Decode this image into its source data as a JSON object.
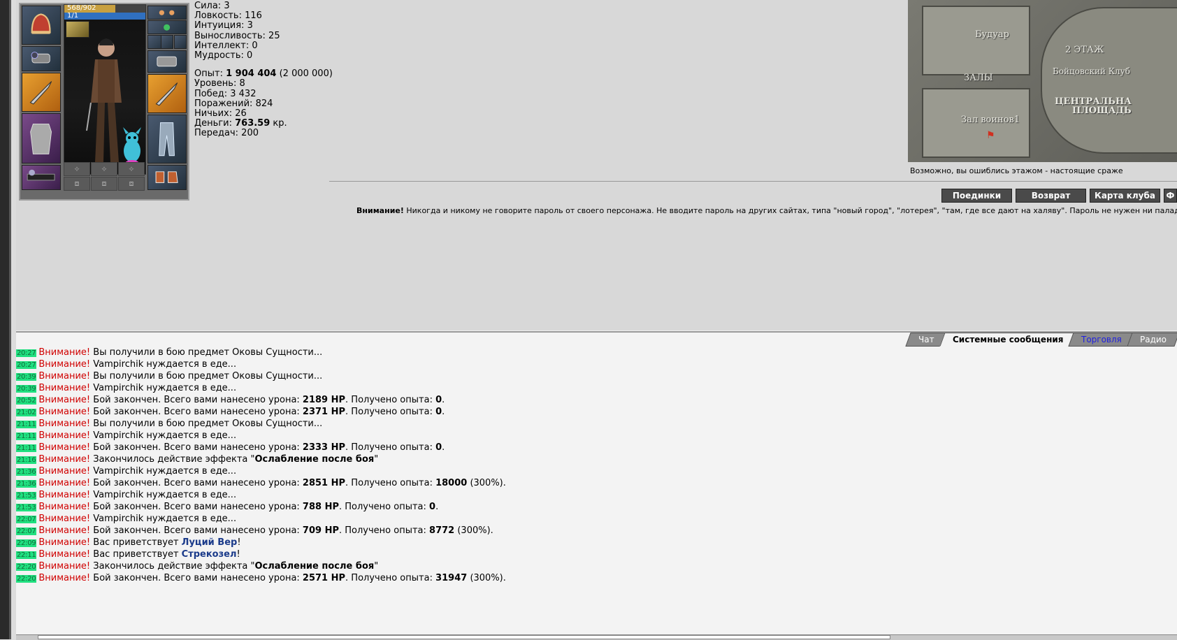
{
  "character": {
    "hp_text": "568/902",
    "hp_fraction": 0.63,
    "mp_text": "1/1"
  },
  "stats": {
    "strength": "Сила: 3",
    "agility": "Ловкость: 116",
    "intuition": "Интуиция: 3",
    "endurance": "Выносливость: 25",
    "intellect": "Интеллект: 0",
    "wisdom": "Мудрость: 0",
    "exp_label": "Опыт: ",
    "exp_value": "1 904 404",
    "exp_next": " (2 000 000)",
    "level": "Уровень: 8",
    "wins": "Побед: 3 432",
    "losses": "Поражений: 824",
    "draws": "Ничьих: 26",
    "money_label": "Деньги: ",
    "money_value": "763.59",
    "money_unit": " кр.",
    "transfers": "Передач: 200"
  },
  "map": {
    "room_boudoir": "Будуар",
    "floor": "2 ЭТАЖ",
    "club": "Бойцовский Клуб",
    "halls": "ЗАЛЫ",
    "central1": "ЦЕНТРАЛЬНА",
    "central2": "ПЛОЩАДЬ",
    "warriors": "Зал воинов1",
    "caption": "Возможно, вы ошиблись этажом - настоящие сраже"
  },
  "nav": {
    "duels": "Поединки",
    "return": "Возврат",
    "club_map": "Карта клуба",
    "more": "Ф"
  },
  "warning": {
    "bold": "Внимание!",
    "text": " Никогда и никому не говорите пароль от своего персонажа. Не вводите пароль на других сайтах, типа \"новый город\", \"лотерея\", \"там, где все дают на халяву\". Пароль не нужен ни паладинам,"
  },
  "tabs": {
    "chat": "Чат",
    "system": "Системные сообщения",
    "trade": "Торговля",
    "radio": "Радио"
  },
  "log": [
    {
      "time": "20:27",
      "label": "Внимание!",
      "parts": [
        {
          "t": " Вы получили в бою предмет Оковы Сущности..."
        }
      ]
    },
    {
      "time": "20:27",
      "label": "Внимание!",
      "parts": [
        {
          "t": " Vampirchik нуждается в еде..."
        }
      ]
    },
    {
      "time": "20:39",
      "label": "Внимание!",
      "parts": [
        {
          "t": " Вы получили в бою предмет Оковы Сущности..."
        }
      ]
    },
    {
      "time": "20:39",
      "label": "Внимание!",
      "parts": [
        {
          "t": " Vampirchik нуждается в еде..."
        }
      ]
    },
    {
      "time": "20:52",
      "label": "Внимание!",
      "parts": [
        {
          "t": " Бой закончен. Всего вами нанесено урона: "
        },
        {
          "t": "2189 HP",
          "b": true
        },
        {
          "t": ". Получено опыта: "
        },
        {
          "t": "0",
          "b": true
        },
        {
          "t": "."
        }
      ]
    },
    {
      "time": "21:02",
      "label": "Внимание!",
      "parts": [
        {
          "t": " Бой закончен. Всего вами нанесено урона: "
        },
        {
          "t": "2371 HP",
          "b": true
        },
        {
          "t": ". Получено опыта: "
        },
        {
          "t": "0",
          "b": true
        },
        {
          "t": "."
        }
      ]
    },
    {
      "time": "21:11",
      "label": "Внимание!",
      "parts": [
        {
          "t": " Вы получили в бою предмет Оковы Сущности..."
        }
      ]
    },
    {
      "time": "21:11",
      "label": "Внимание!",
      "parts": [
        {
          "t": " Vampirchik нуждается в еде..."
        }
      ]
    },
    {
      "time": "21:11",
      "label": "Внимание!",
      "parts": [
        {
          "t": " Бой закончен. Всего вами нанесено урона: "
        },
        {
          "t": "2333 HP",
          "b": true
        },
        {
          "t": ". Получено опыта: "
        },
        {
          "t": "0",
          "b": true
        },
        {
          "t": "."
        }
      ]
    },
    {
      "time": "21:16",
      "label": "Внимание!",
      "parts": [
        {
          "t": " Закончилось действие эффекта \""
        },
        {
          "t": "Ослабление после боя",
          "b": true
        },
        {
          "t": "\""
        }
      ]
    },
    {
      "time": "21:36",
      "label": "Внимание!",
      "parts": [
        {
          "t": " Vampirchik нуждается в еде..."
        }
      ]
    },
    {
      "time": "21:36",
      "label": "Внимание!",
      "parts": [
        {
          "t": " Бой закончен. Всего вами нанесено урона: "
        },
        {
          "t": "2851 HP",
          "b": true
        },
        {
          "t": ". Получено опыта: "
        },
        {
          "t": "18000",
          "b": true
        },
        {
          "t": " (300%)."
        }
      ]
    },
    {
      "time": "21:53",
      "label": "Внимание!",
      "parts": [
        {
          "t": " Vampirchik нуждается в еде..."
        }
      ]
    },
    {
      "time": "21:53",
      "label": "Внимание!",
      "parts": [
        {
          "t": " Бой закончен. Всего вами нанесено урона: "
        },
        {
          "t": "788 HP",
          "b": true
        },
        {
          "t": ". Получено опыта: "
        },
        {
          "t": "0",
          "b": true
        },
        {
          "t": "."
        }
      ]
    },
    {
      "time": "22:07",
      "label": "Внимание!",
      "parts": [
        {
          "t": " Vampirchik нуждается в еде..."
        }
      ]
    },
    {
      "time": "22:07",
      "label": "Внимание!",
      "parts": [
        {
          "t": " Бой закончен. Всего вами нанесено урона: "
        },
        {
          "t": "709 HP",
          "b": true
        },
        {
          "t": ". Получено опыта: "
        },
        {
          "t": "8772",
          "b": true
        },
        {
          "t": " (300%)."
        }
      ]
    },
    {
      "time": "22:09",
      "label": "Внимание!",
      "parts": [
        {
          "t": " Вас приветствует "
        },
        {
          "t": "Луций Вер",
          "nick": true
        },
        {
          "t": "!"
        }
      ]
    },
    {
      "time": "22:11",
      "label": "Внимание!",
      "parts": [
        {
          "t": " Вас приветствует "
        },
        {
          "t": "Стрекозел",
          "nick": true
        },
        {
          "t": "!"
        }
      ]
    },
    {
      "time": "22:20",
      "label": "Внимание!",
      "parts": [
        {
          "t": " Закончилось действие эффекта \""
        },
        {
          "t": "Ослабление после боя",
          "b": true
        },
        {
          "t": "\""
        }
      ]
    },
    {
      "time": "22:20",
      "label": "Внимание!",
      "parts": [
        {
          "t": " Бой закончен. Всего вами нанесено урона: "
        },
        {
          "t": "2571 HP",
          "b": true
        },
        {
          "t": ". Получено опыта: "
        },
        {
          "t": "31947",
          "b": true
        },
        {
          "t": " (300%)."
        }
      ]
    }
  ]
}
